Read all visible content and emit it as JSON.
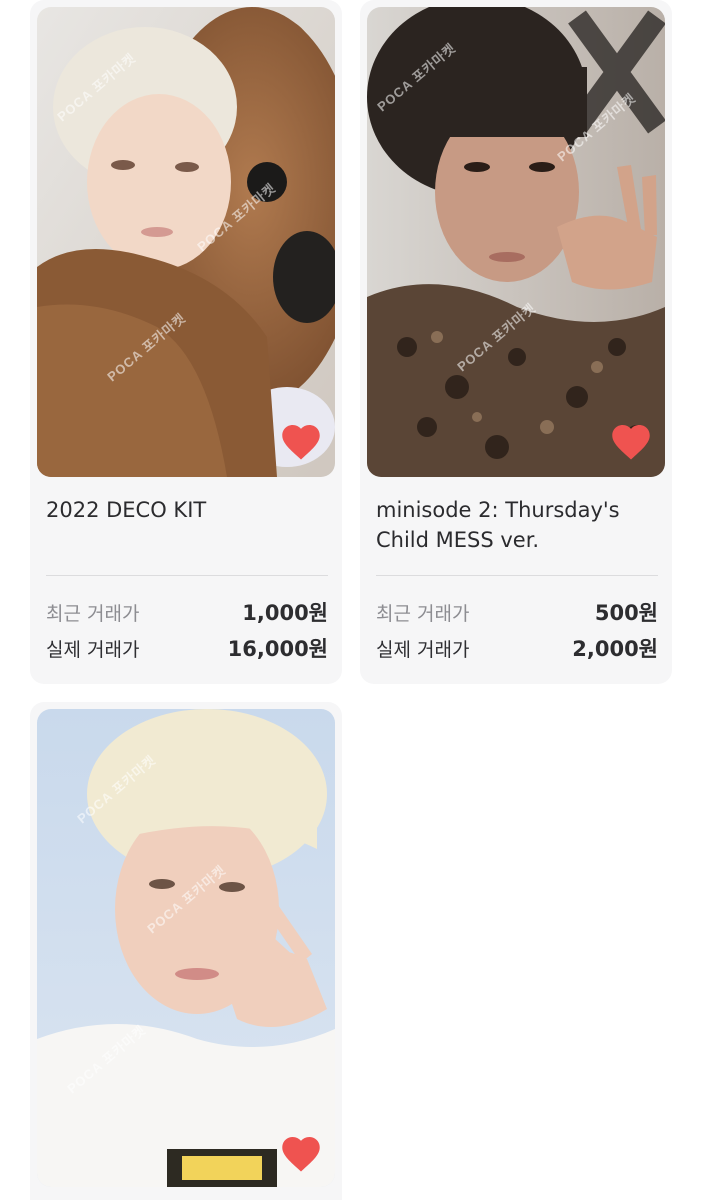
{
  "theme": {
    "card_bg": "#f6f6f7",
    "heart_color": "#ef5350",
    "text_primary": "#2d2d30",
    "text_muted": "#8d8d92"
  },
  "watermark": "POCA 포카마켓",
  "products": [
    {
      "title": "2022 DECO KIT",
      "recent_label": "최근 거래가",
      "recent_price": "1,000원",
      "actual_label": "실제 거래가",
      "actual_price": "16,000원",
      "liked": true,
      "heart_icon": "heart-icon"
    },
    {
      "title": "minisode 2: Thursday's Child MESS ver.",
      "recent_label": "최근 거래가",
      "recent_price": "500원",
      "actual_label": "실제 거래가",
      "actual_price": "2,000원",
      "liked": true,
      "heart_icon": "heart-icon"
    },
    {
      "liked": true,
      "heart_icon": "heart-icon"
    }
  ]
}
